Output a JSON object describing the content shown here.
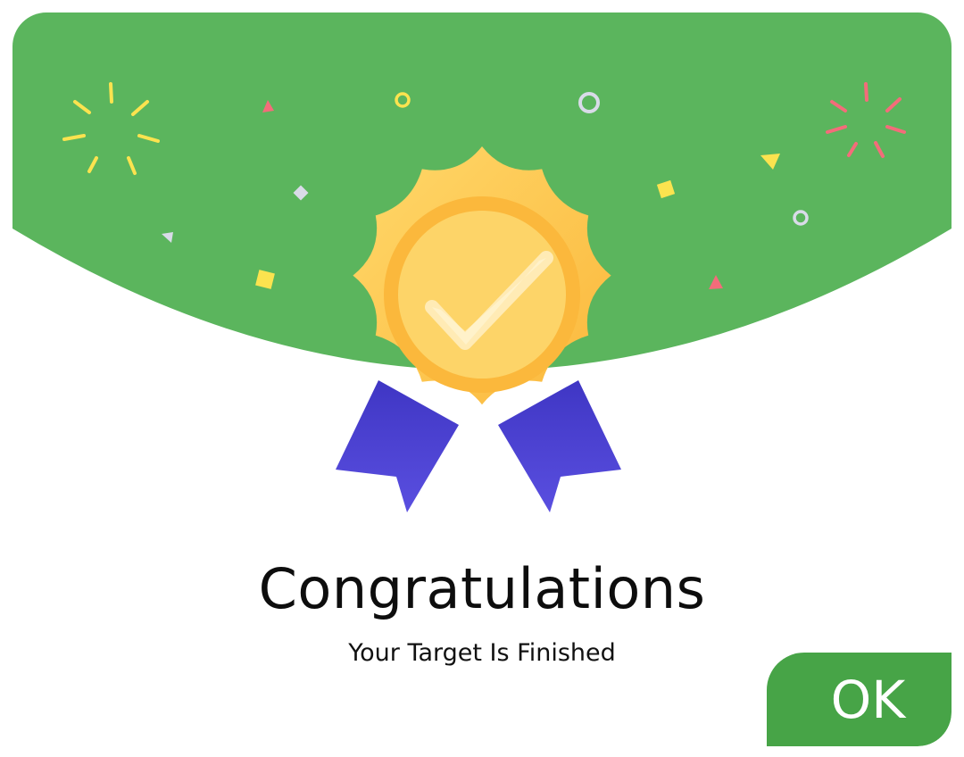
{
  "dialog": {
    "title": "Congratulations",
    "subtitle": "Your Target Is Finished",
    "ok_label": "OK"
  },
  "colors": {
    "header_green": "#5bb55d",
    "button_green": "#47a447",
    "medal_gold": "#fdc34e",
    "ribbon_purple": "#5044d4",
    "confetti_yellow": "#fbe34f",
    "confetti_pink": "#f46c7a",
    "confetti_gray": "#d9dbe8"
  },
  "icons": {
    "medal": "award-medal-checkmark-icon",
    "decoration": "confetti-fireworks"
  }
}
